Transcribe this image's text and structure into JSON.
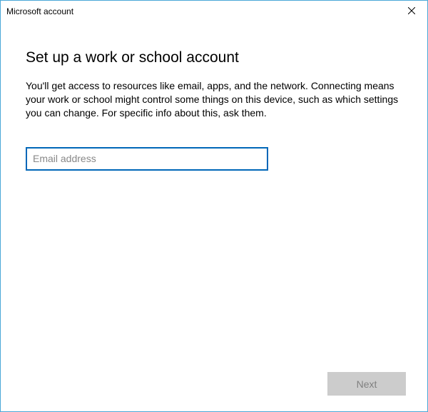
{
  "titlebar": {
    "title": "Microsoft account"
  },
  "content": {
    "heading": "Set up a work or school account",
    "description": "You'll get access to resources like email, apps, and the network. Connecting means your work or school might control some things on this device, such as which settings you can change. For specific info about this, ask them."
  },
  "form": {
    "email_placeholder": "Email address",
    "email_value": ""
  },
  "buttons": {
    "next_label": "Next"
  }
}
